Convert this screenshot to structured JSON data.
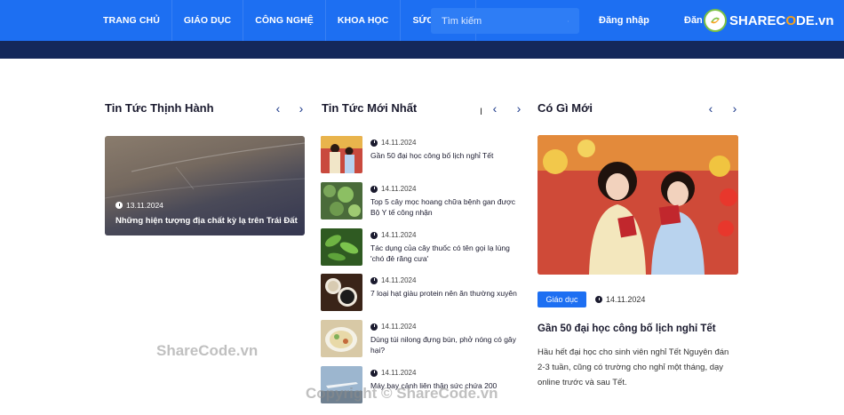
{
  "header": {
    "nav": [
      "TRANG CHỦ",
      "GIÁO DỤC",
      "CÔNG NGHỆ",
      "KHOA HỌC",
      "SỨC KHỎE"
    ],
    "search_placeholder": "Tìm kiếm",
    "login_label": "Đăng nhập",
    "register_label": "Đăn",
    "logo_text_1": "SHAREC",
    "logo_text_o": "O",
    "logo_text_2": "DE.vn",
    "brand_color": "#1d6ff2"
  },
  "sections": {
    "trending": {
      "title": "Tin Tức Thịnh Hành",
      "card": {
        "date": "13.11.2024",
        "title": "Những hiện tượng địa chất kỳ lạ trên Trái Đất"
      }
    },
    "latest": {
      "title": "Tin Tức Mới Nhất",
      "items": [
        {
          "date": "14.11.2024",
          "title": "Gần 50 đại học công bố lịch nghỉ Tết",
          "thumb": "two-girls"
        },
        {
          "date": "14.11.2024",
          "title": "Top 5 cây mọc hoang chữa bệnh gan được Bộ Y tế công nhận",
          "thumb": "green-herb"
        },
        {
          "date": "14.11.2024",
          "title": "Tác dụng của cây thuốc có tên gọi lạ lùng 'chó đẻ răng cưa'",
          "thumb": "leaf-plant"
        },
        {
          "date": "14.11.2024",
          "title": "7 loại hạt giàu protein nên ăn thường xuyên",
          "thumb": "nuts-bowl"
        },
        {
          "date": "14.11.2024",
          "title": "Dùng túi nilong đựng bún, phở nóng có gây hại?",
          "thumb": "noodle-bowl"
        },
        {
          "date": "14.11.2024",
          "title": "Máy bay cảnh liên thân sức chứa 200",
          "thumb": "airplane"
        }
      ]
    },
    "whats_new": {
      "title": "Có Gì Mới",
      "badge": "Giáo dục",
      "date": "14.11.2024",
      "title_text": "Gần 50 đại học công bố lịch nghỉ Tết",
      "desc": "Hầu hết đại học cho sinh viên nghỉ Tết Nguyên đán 2-3 tuần, cũng có trường cho nghỉ một tháng, dạy online trước và sau Tết."
    }
  },
  "watermarks": {
    "left": "ShareCode.vn",
    "bottom": "Copyright © ShareCode.vn"
  },
  "icons": {
    "prev": "‹",
    "next": "›",
    "cursor": "I"
  }
}
